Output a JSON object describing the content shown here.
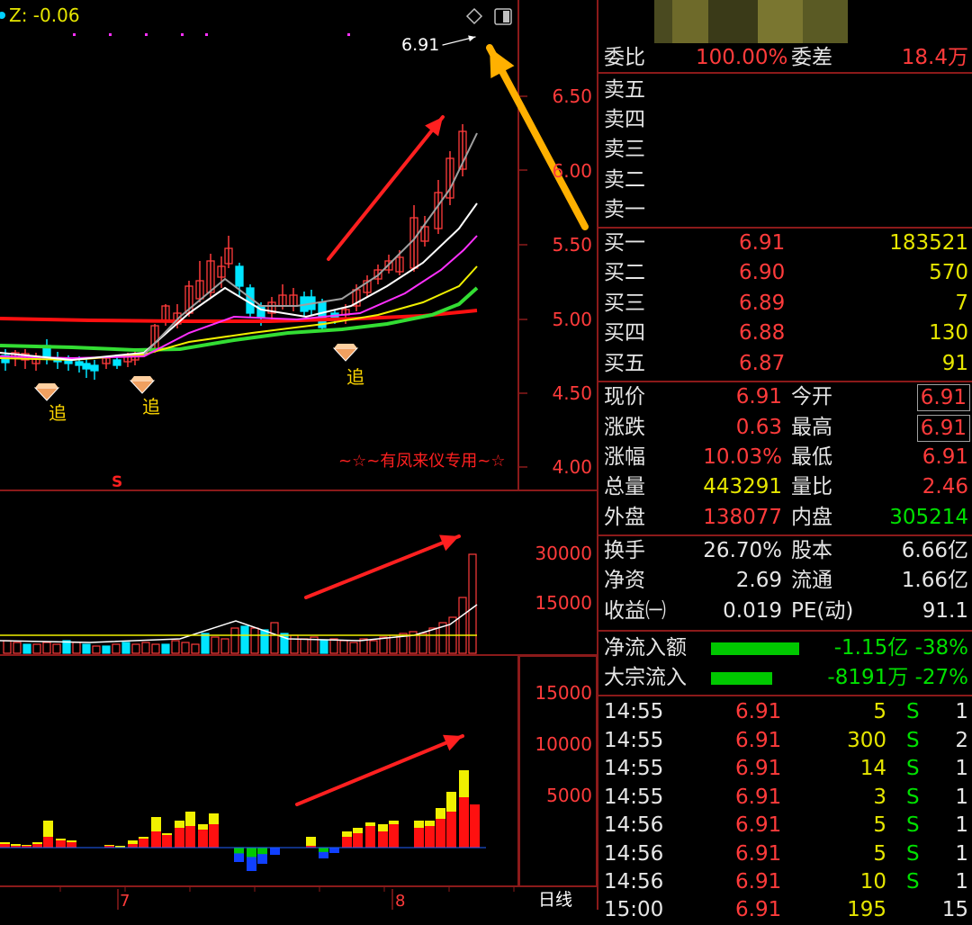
{
  "header": {
    "z_label": "Z: -0.06",
    "price_callout": "6.91"
  },
  "main_chart": {
    "y_ticks": [
      "6.50",
      "6.00",
      "5.50",
      "5.00",
      "4.50",
      "4.00"
    ],
    "signal_labels": [
      "追",
      "追",
      "追"
    ],
    "watermark": "~☆~有凤来仪专用~☆",
    "s_marker": "S"
  },
  "volume_chart": {
    "y_ticks": [
      "30000",
      "15000"
    ]
  },
  "flow_chart": {
    "y_ticks": [
      "15000",
      "10000",
      "5000"
    ]
  },
  "x_axis": {
    "labels": [
      "7",
      "8"
    ],
    "period": "日线"
  },
  "quote": {
    "weibi_label": "委比",
    "weibi_value": "100.00%",
    "weicha_label": "委差",
    "weicha_value": "18.4万",
    "asks": [
      {
        "label": "卖五",
        "price": "",
        "vol": ""
      },
      {
        "label": "卖四",
        "price": "",
        "vol": ""
      },
      {
        "label": "卖三",
        "price": "",
        "vol": ""
      },
      {
        "label": "卖二",
        "price": "",
        "vol": ""
      },
      {
        "label": "卖一",
        "price": "",
        "vol": ""
      }
    ],
    "bids": [
      {
        "label": "买一",
        "price": "6.91",
        "vol": "183521"
      },
      {
        "label": "买二",
        "price": "6.90",
        "vol": "570"
      },
      {
        "label": "买三",
        "price": "6.89",
        "vol": "7"
      },
      {
        "label": "买四",
        "price": "6.88",
        "vol": "130"
      },
      {
        "label": "买五",
        "price": "6.87",
        "vol": "91"
      }
    ],
    "stats": [
      {
        "l1": "现价",
        "v1": "6.91",
        "l2": "今开",
        "v2": "6.91"
      },
      {
        "l1": "涨跌",
        "v1": "0.63",
        "l2": "最高",
        "v2": "6.91"
      },
      {
        "l1": "涨幅",
        "v1": "10.03%",
        "l2": "最低",
        "v2": "6.91"
      },
      {
        "l1": "总量",
        "v1": "443291",
        "l2": "量比",
        "v2": "2.46"
      },
      {
        "l1": "外盘",
        "v1": "138077",
        "l2": "内盘",
        "v2": "305214"
      }
    ],
    "fundamentals": [
      {
        "l1": "换手",
        "v1": "26.70%",
        "l2": "股本",
        "v2": "6.66亿"
      },
      {
        "l1": "净资",
        "v1": "2.69",
        "l2": "流通",
        "v2": "1.66亿"
      },
      {
        "l1": "收益㈠",
        "v1": "0.019",
        "l2": "PE(动)",
        "v2": "91.1"
      }
    ],
    "flows": [
      {
        "label": "净流入额",
        "value": "-1.15亿 -38%"
      },
      {
        "label": "大宗流入",
        "value": "-8191万 -27%"
      }
    ],
    "ticks": [
      {
        "time": "14:55",
        "price": "6.91",
        "vol": "5",
        "side": "S",
        "n": "1"
      },
      {
        "time": "14:55",
        "price": "6.91",
        "vol": "300",
        "side": "S",
        "n": "2"
      },
      {
        "time": "14:55",
        "price": "6.91",
        "vol": "14",
        "side": "S",
        "n": "1"
      },
      {
        "time": "14:55",
        "price": "6.91",
        "vol": "3",
        "side": "S",
        "n": "1"
      },
      {
        "time": "14:56",
        "price": "6.91",
        "vol": "5",
        "side": "S",
        "n": "1"
      },
      {
        "time": "14:56",
        "price": "6.91",
        "vol": "5",
        "side": "S",
        "n": "1"
      },
      {
        "time": "14:56",
        "price": "6.91",
        "vol": "10",
        "side": "S",
        "n": "1"
      },
      {
        "time": "15:00",
        "price": "6.91",
        "vol": "195",
        "side": "",
        "n": "15"
      }
    ]
  },
  "colors": {
    "up": "#ff3b3b",
    "down": "#00e5ff",
    "ma_red": "#ff1010",
    "ma_green": "#33dd33",
    "ma_yellow": "#f0f000",
    "ma_magenta": "#ff30ff",
    "ma_white": "#ffffff",
    "ma_gray": "#a0a0a0",
    "arrow_red": "#ff2020",
    "arrow_orange": "#ffb000",
    "signal_text": "#ffd700"
  }
}
